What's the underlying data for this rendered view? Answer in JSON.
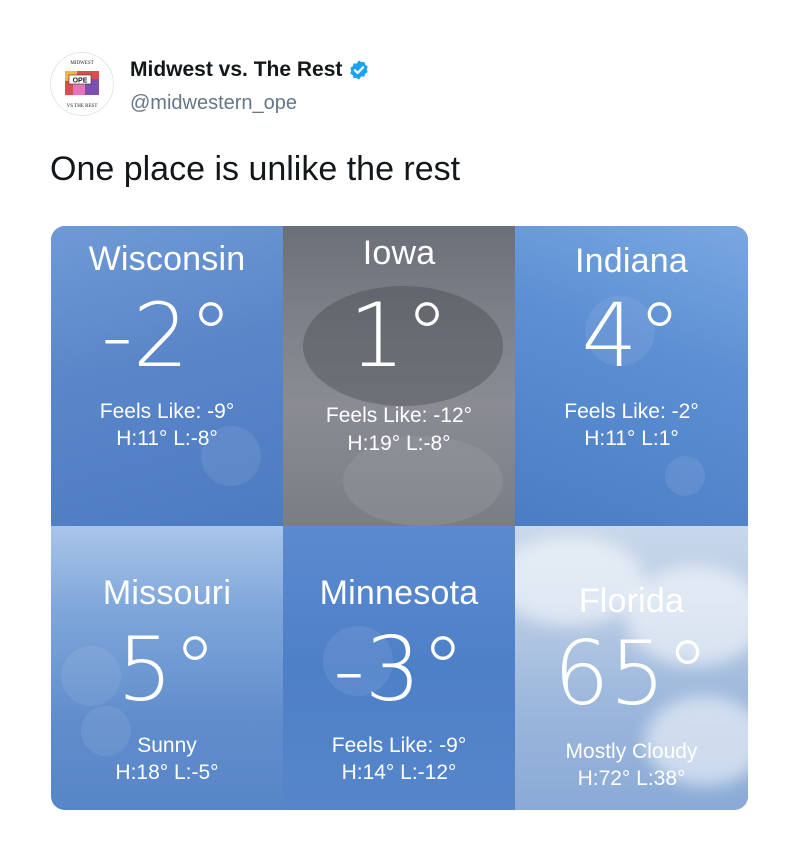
{
  "tweet": {
    "display_name": "Midwest vs. The Rest",
    "handle": "@midwestern_ope",
    "text": "One place is unlike the rest",
    "avatar": {
      "icon": "midwest-logo",
      "logo_text_top": "MIDWEST",
      "logo_text_mid": "OPE",
      "logo_text_bottom": "VS THE REST"
    },
    "verified": true
  },
  "colors": {
    "verified": "#1da1f2",
    "handle": "#657786",
    "text": "#14171a"
  },
  "tiles": [
    {
      "city": "Wisconsin",
      "temp": "-2°",
      "line1": "Feels Like: -9°",
      "line2": "H:11°  L:-8°"
    },
    {
      "city": "Iowa",
      "temp": "1°",
      "line1": "Feels Like: -12°",
      "line2": "H:19°  L:-8°"
    },
    {
      "city": "Indiana",
      "temp": "4°",
      "line1": "Feels Like: -2°",
      "line2": "H:11°  L:1°"
    },
    {
      "city": "Missouri",
      "temp": "5°",
      "line1": "Sunny",
      "line2": "H:18°  L:-5°"
    },
    {
      "city": "Minnesota",
      "temp": "-3°",
      "line1": "Feels Like: -9°",
      "line2": "H:14°  L:-12°"
    },
    {
      "city": "Florida",
      "temp": "65°",
      "line1": "Mostly Cloudy",
      "line2": "H:72°  L:38°"
    }
  ]
}
